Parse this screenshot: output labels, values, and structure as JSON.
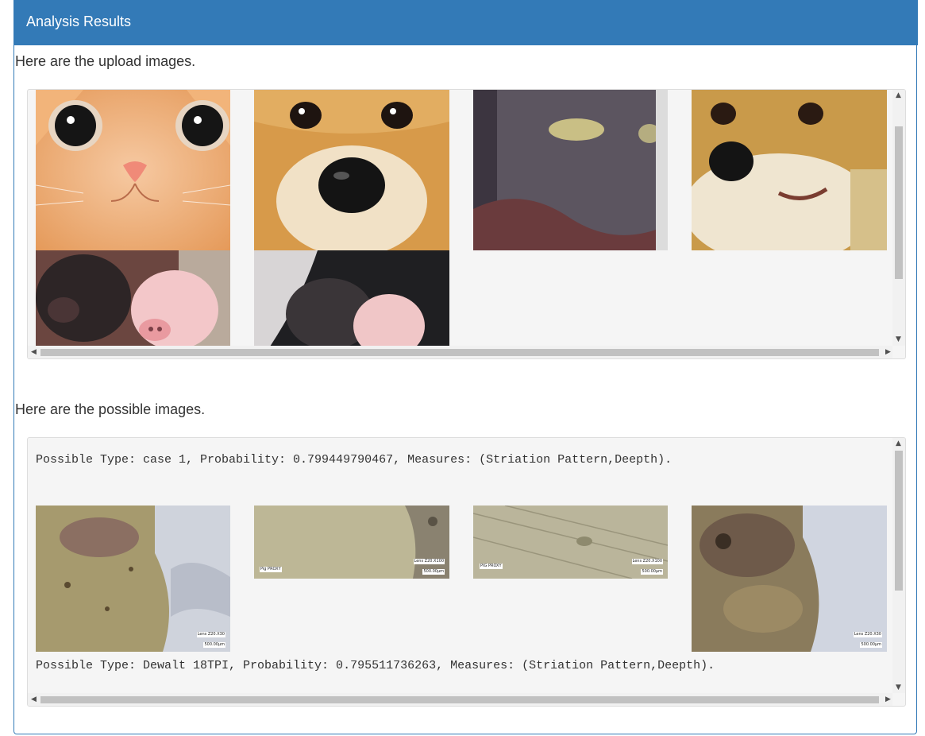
{
  "panel": {
    "title": "Analysis Results"
  },
  "upload_section": {
    "label": "Here are the upload images.",
    "images": [
      {
        "icon": "orange-cat-face-photo"
      },
      {
        "icon": "shiba-dog-face-photo"
      },
      {
        "icon": "blurry-gray-cat-photo"
      },
      {
        "icon": "corgi-face-photo"
      },
      {
        "icon": "two-piglets-photo"
      },
      {
        "icon": "piglets-in-blanket-photo"
      }
    ]
  },
  "possible_section": {
    "label": "Here are the possible images.",
    "results": [
      {
        "text": "Possible Type: case 1, Probability: 0.799449790467, Measures: (Striation Pattern,Deepth).",
        "images": [
          {
            "icon": "microscope-photo",
            "lens": "Lens Z20.X30",
            "scale": "500.00µm"
          },
          {
            "icon": "microscope-photo",
            "lens": "Lens Z20.X100",
            "scale": "500.00µm",
            "tag": "Pig PROXY"
          },
          {
            "icon": "microscope-photo",
            "lens": "Lens Z20.X100",
            "scale": "500.00µm",
            "tag": "PIG PROXY"
          },
          {
            "icon": "microscope-photo",
            "lens": "Lens Z20.X30",
            "scale": "500.00µm"
          }
        ]
      },
      {
        "text": "Possible Type: Dewalt 18TPI, Probability: 0.795511736263, Measures: (Striation Pattern,Deepth)."
      }
    ]
  }
}
